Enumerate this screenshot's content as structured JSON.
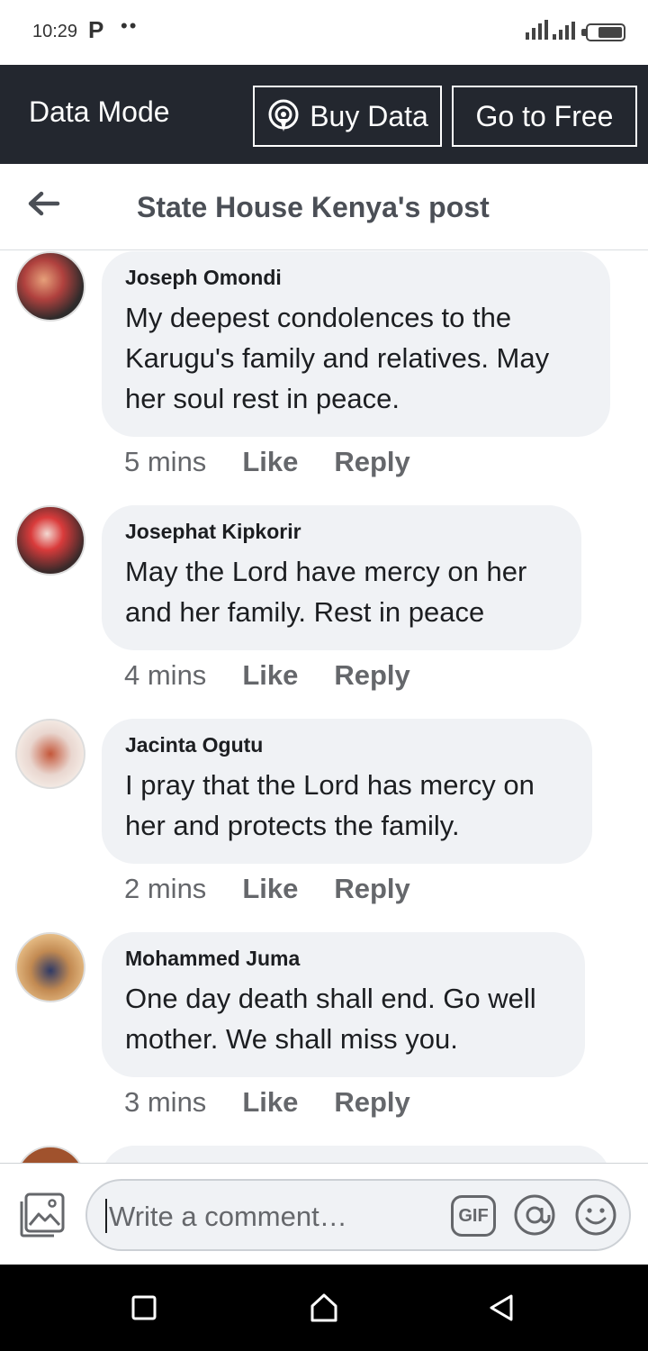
{
  "status_bar": {
    "time": "10:29",
    "app_letter": "P",
    "dots": "••"
  },
  "data_bar": {
    "mode_label": "Data Mode",
    "buy_label": "Buy Data",
    "free_label": "Go to Free"
  },
  "header": {
    "title": "State House Kenya's post"
  },
  "comments": [
    {
      "author": "Joseph Omondi",
      "text": "My deepest condolences to the Karugu's family and relatives. May her soul rest in peace.",
      "time": "5 mins",
      "like": "Like",
      "reply": "Reply"
    },
    {
      "author": "Josephat Kipkorir",
      "text": "May the Lord have mercy on her and her family. Rest in peace",
      "time": "4 mins",
      "like": "Like",
      "reply": "Reply"
    },
    {
      "author": "Jacinta Ogutu",
      "text": "I pray that the Lord has mercy on her and protects the family.",
      "time": "2 mins",
      "like": "Like",
      "reply": "Reply"
    },
    {
      "author": "Mohammed Juma",
      "text": "One day death shall end. Go well mother. We shall miss you.",
      "time": "3 mins",
      "like": "Like",
      "reply": "Reply"
    }
  ],
  "composer": {
    "placeholder": "Write a comment…",
    "gif_label": "GIF"
  },
  "icons": {
    "back": "back-arrow-icon",
    "buy": "broadcast-icon",
    "photo": "photo-icon",
    "gif": "gif-icon",
    "mention": "at-icon",
    "emoji": "emoji-icon",
    "nav": [
      "recents-square-icon",
      "home-icon",
      "back-triangle-icon"
    ]
  },
  "colors": {
    "data_bar_bg": "#23272f",
    "bubble_bg": "#f0f2f5",
    "meta_text": "#65676b"
  }
}
